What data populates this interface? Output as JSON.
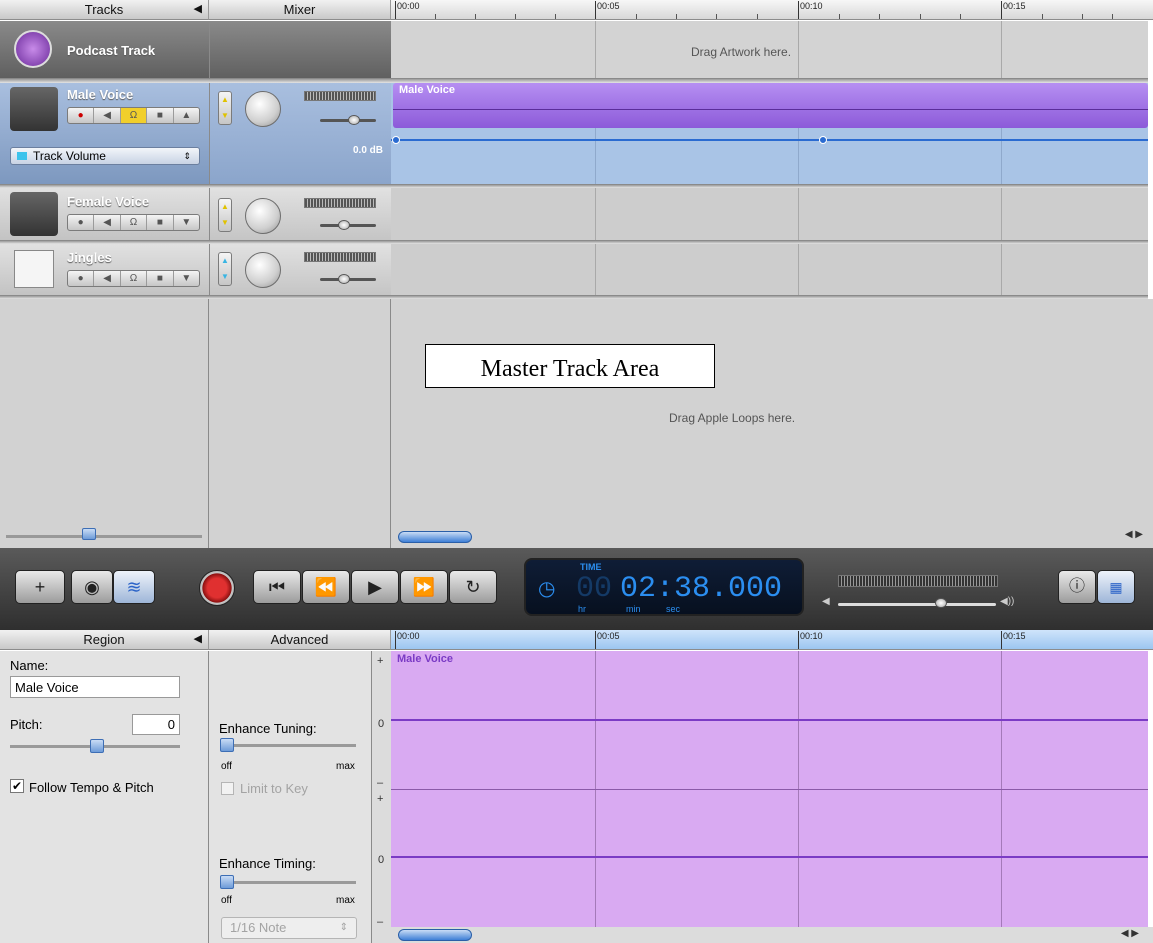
{
  "tracks_header": {
    "label": "Tracks",
    "collapse": "◀"
  },
  "mixer_header": {
    "label": "Mixer"
  },
  "timeline": {
    "ticks": [
      "00:00",
      "00:05",
      "00:10",
      "00:15"
    ]
  },
  "tracks": [
    {
      "name": "Podcast Track",
      "lane_hint": "Drag Artwork here."
    },
    {
      "name": "Male Voice",
      "region": "Male Voice",
      "automation": "Track Volume",
      "volume_db": "0.0 dB"
    },
    {
      "name": "Female Voice"
    },
    {
      "name": "Jingles"
    }
  ],
  "empty_area": {
    "annotation": "Master Track Area",
    "hint": "Drag Apple Loops here."
  },
  "transport": {
    "time_label": "TIME",
    "time_value": "02:38.000",
    "time_dim": "00",
    "units": [
      "hr",
      "min",
      "sec"
    ]
  },
  "region_header": {
    "label": "Region",
    "collapse": "◀"
  },
  "advanced_header": {
    "label": "Advanced"
  },
  "region": {
    "name_label": "Name:",
    "name_value": "Male Voice",
    "pitch_label": "Pitch:",
    "pitch_value": "0",
    "follow_label": "Follow Tempo & Pitch",
    "follow_checked": true
  },
  "advanced": {
    "tuning_label": "Enhance Tuning:",
    "limit_label": "Limit to Key",
    "timing_label": "Enhance Timing:",
    "off": "off",
    "max": "max",
    "note_value": "1/16 Note"
  },
  "editor": {
    "region": "Male Voice",
    "plus": "+",
    "minus": "–",
    "zero": "0"
  },
  "colors": {
    "selected_track": "#8fa7c9",
    "region_purple": "#9d6fe0",
    "editor_bg": "#d9aaf2",
    "lcd": "#1e8cf0"
  }
}
